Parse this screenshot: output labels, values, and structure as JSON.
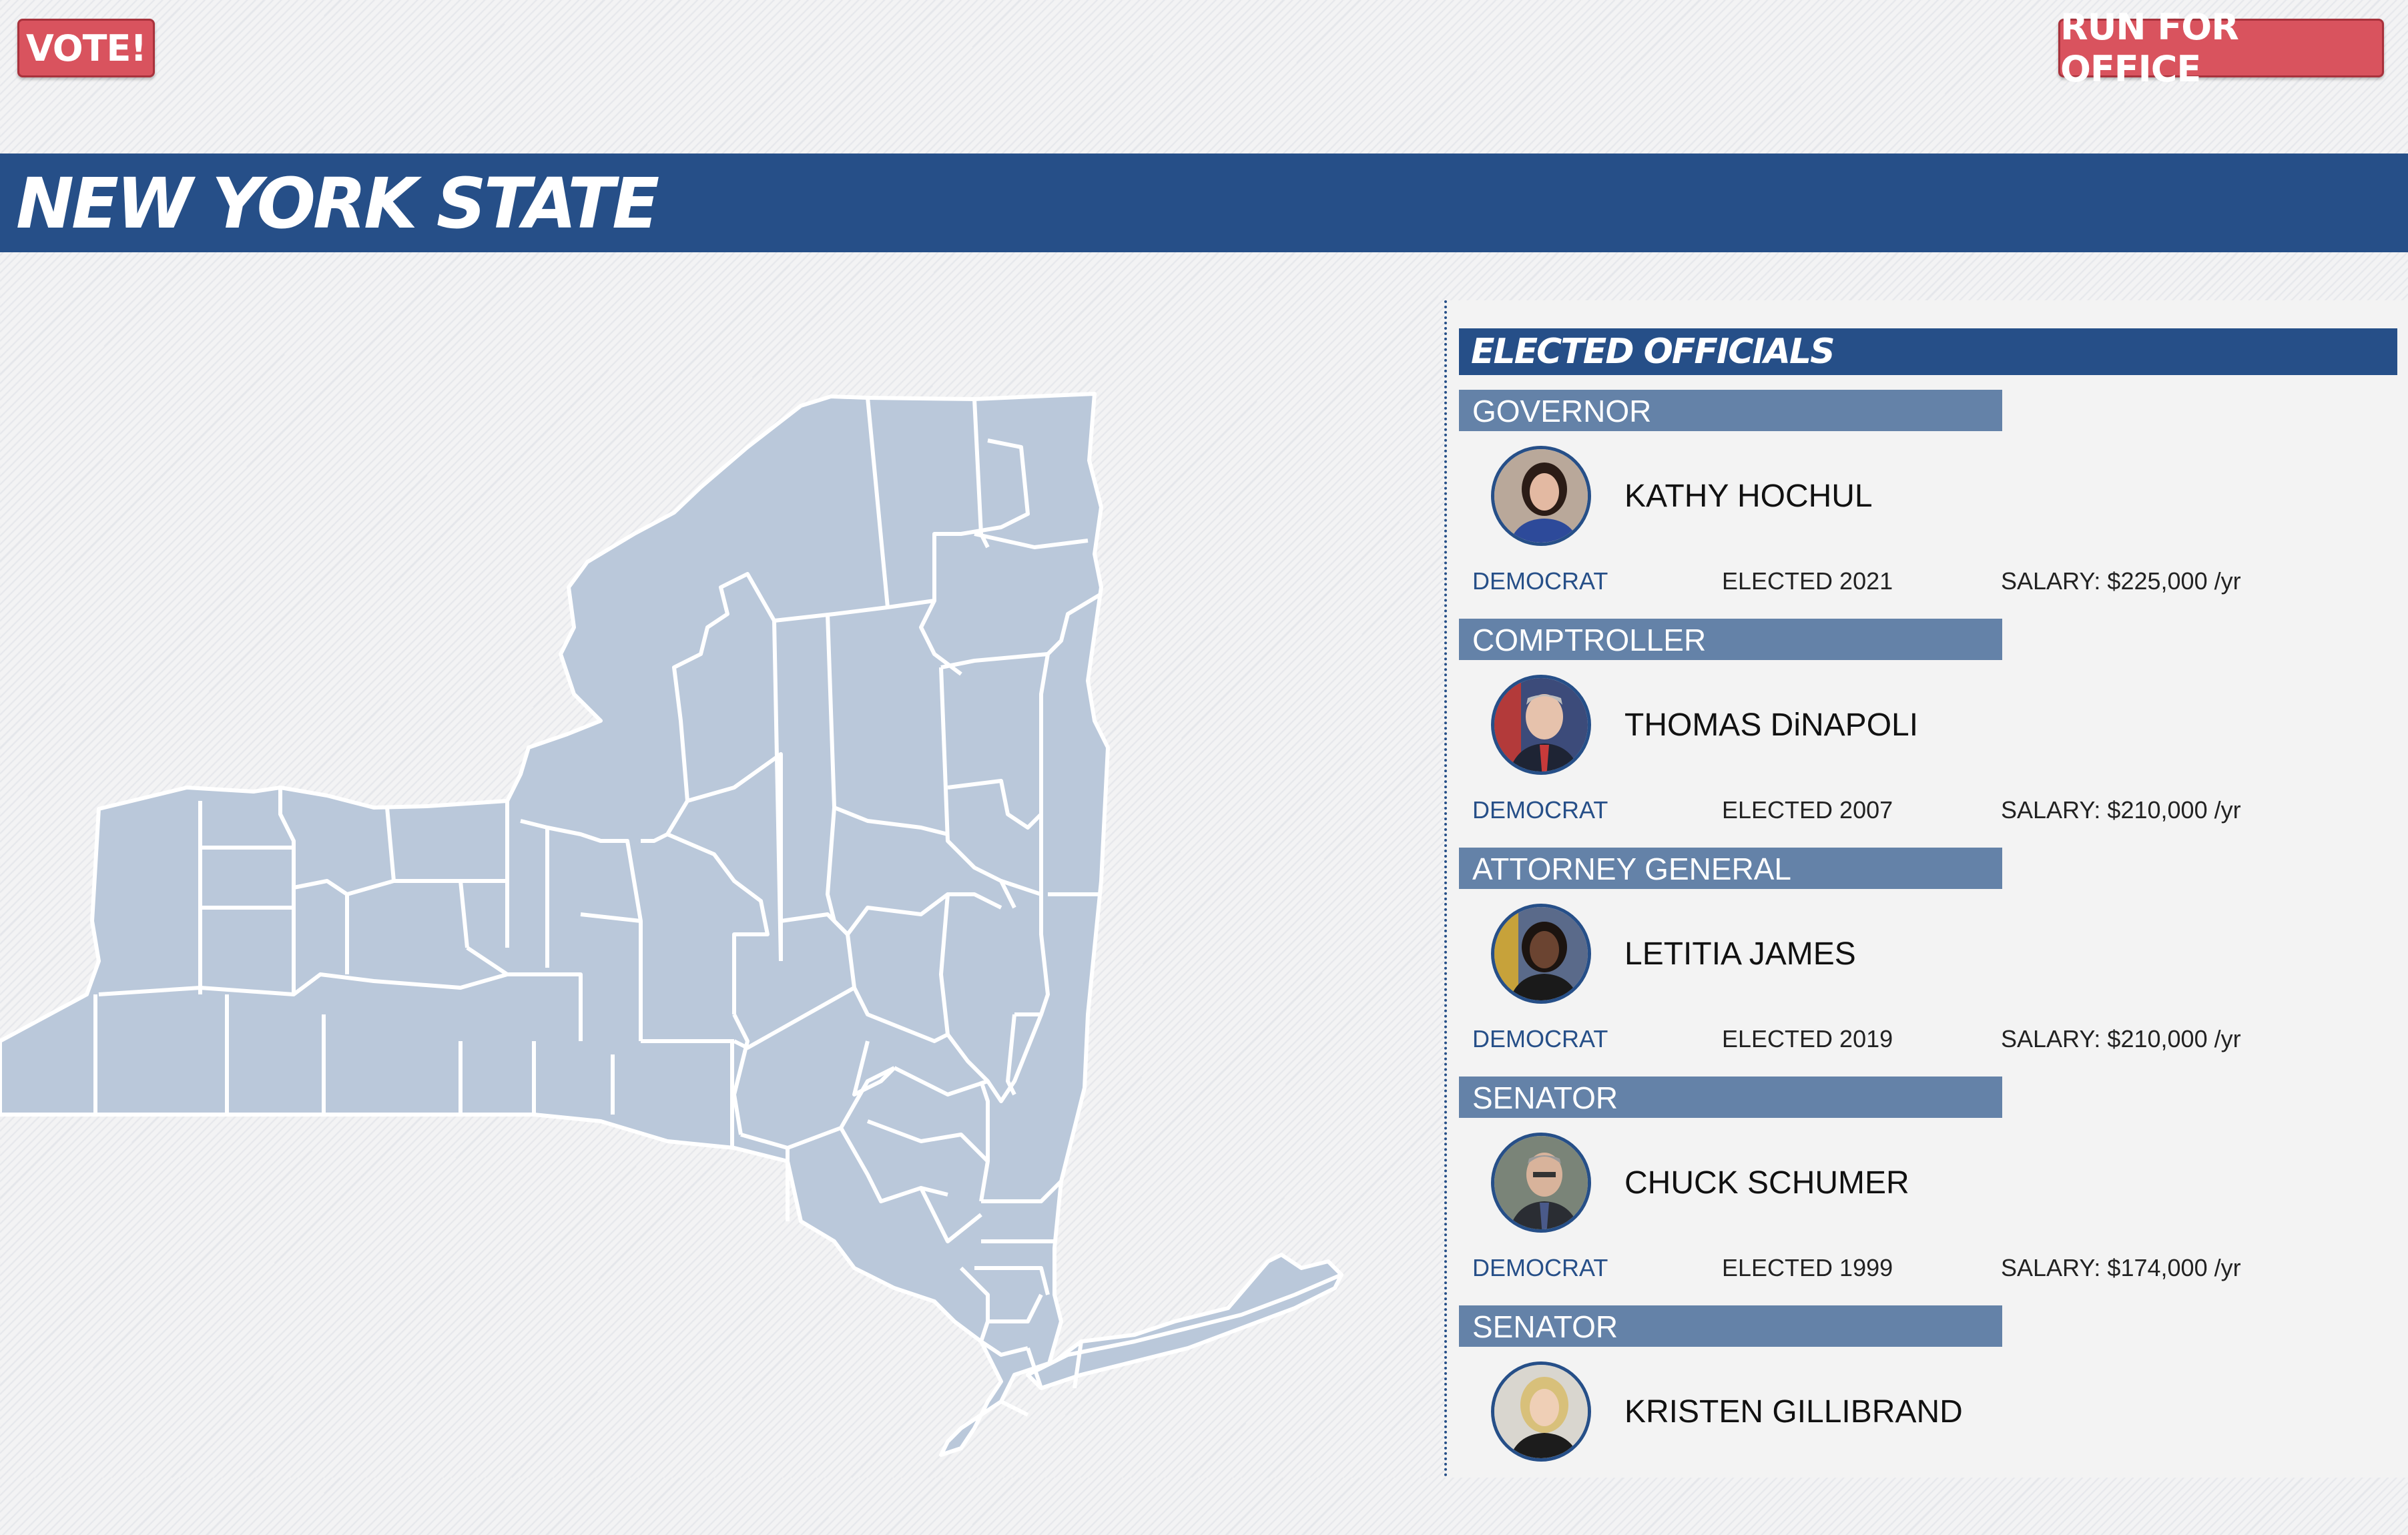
{
  "header": {
    "vote_label": "VOTE!",
    "run_label": "RUN FOR OFFICE"
  },
  "banner": {
    "title": "NEW YORK STATE"
  },
  "map": {
    "name": "new-york-state-counties-map",
    "fill": "#bac8da",
    "border": "#ffffff"
  },
  "officials": {
    "heading": "ELECTED OFFICIALS",
    "items": [
      {
        "role": "GOVERNOR",
        "name": "KATHY HOCHUL",
        "party": "DEMOCRAT",
        "elected": "ELECTED 2021",
        "salary": "SALARY: $225,000 /yr"
      },
      {
        "role": "COMPTROLLER",
        "name": "THOMAS DiNAPOLI",
        "party": "DEMOCRAT",
        "elected": "ELECTED 2007",
        "salary": "SALARY: $210,000 /yr"
      },
      {
        "role": "ATTORNEY GENERAL",
        "name": "LETITIA JAMES",
        "party": "DEMOCRAT",
        "elected": "ELECTED 2019",
        "salary": "SALARY: $210,000 /yr"
      },
      {
        "role": "SENATOR",
        "name": "CHUCK SCHUMER",
        "party": "DEMOCRAT",
        "elected": "ELECTED 1999",
        "salary": "SALARY: $174,000 /yr"
      },
      {
        "role": "SENATOR",
        "name": "KRISTEN GILLIBRAND"
      }
    ]
  },
  "colors": {
    "accent_red": "#d9535e",
    "navy": "#264f88",
    "role_bar": "#6482a8"
  }
}
